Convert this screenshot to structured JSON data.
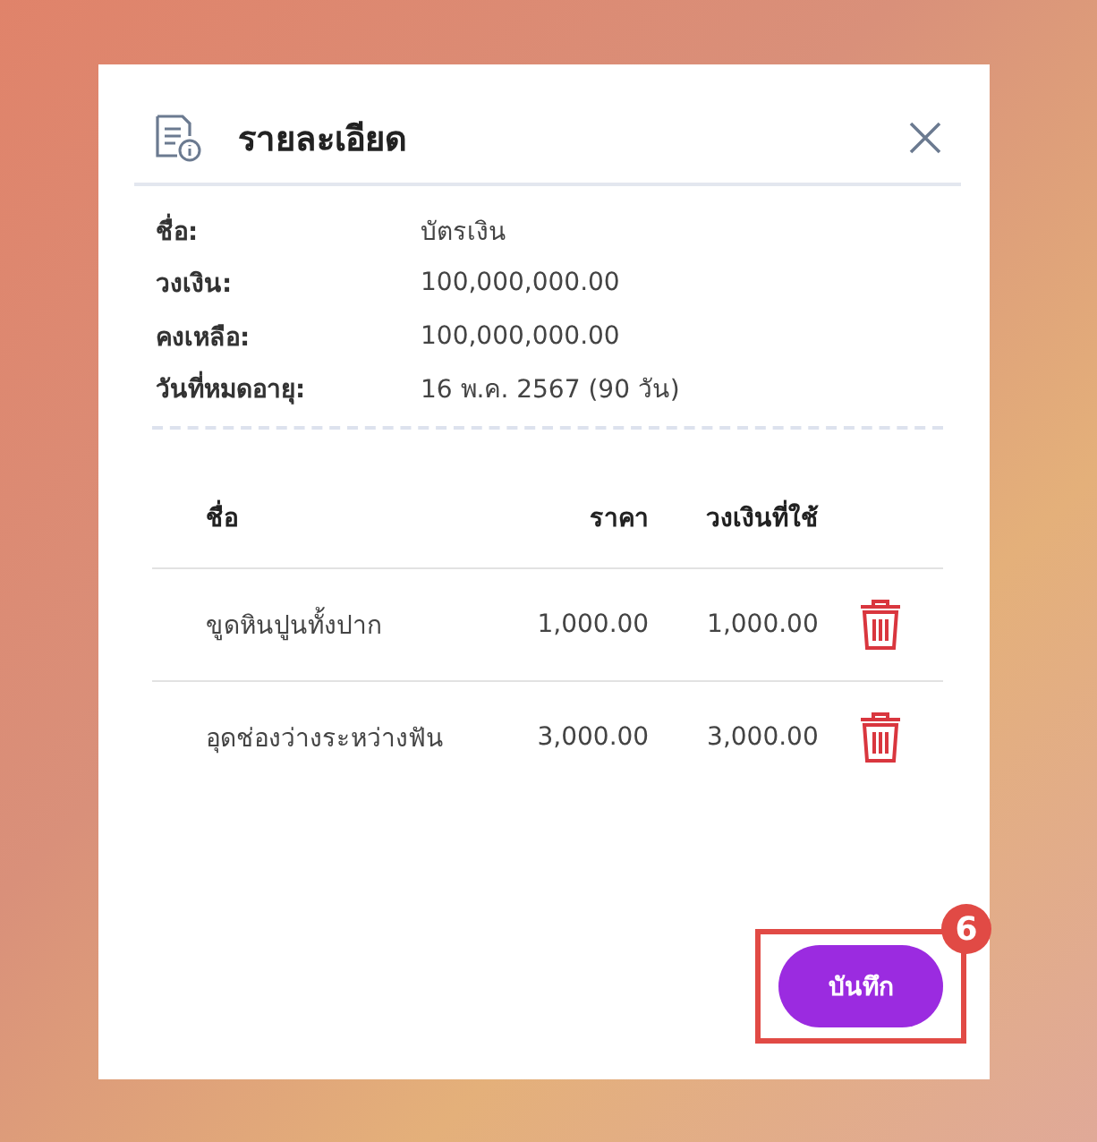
{
  "dialog": {
    "title": "รายละเอียด"
  },
  "details": [
    {
      "label": "ชื่อ:",
      "value": "บัตรเงิน"
    },
    {
      "label": "วงเงิน:",
      "value": "100,000,000.00"
    },
    {
      "label": "คงเหลือ:",
      "value": "100,000,000.00"
    },
    {
      "label": "วันที่หมดอายุ:",
      "value": "16 พ.ค. 2567 (90 วัน)"
    }
  ],
  "table": {
    "columns": [
      "ชื่อ",
      "ราคา",
      "วงเงินที่ใช้"
    ],
    "rows": [
      {
        "name": "ขูดหินปูนทั้งปาก",
        "price": "1,000.00",
        "used": "1,000.00"
      },
      {
        "name": "อุดช่องว่างระหว่างฟัน",
        "price": "3,000.00",
        "used": "3,000.00"
      }
    ]
  },
  "save_button": {
    "label": "บันทึก"
  },
  "annotation": {
    "step": "6"
  }
}
